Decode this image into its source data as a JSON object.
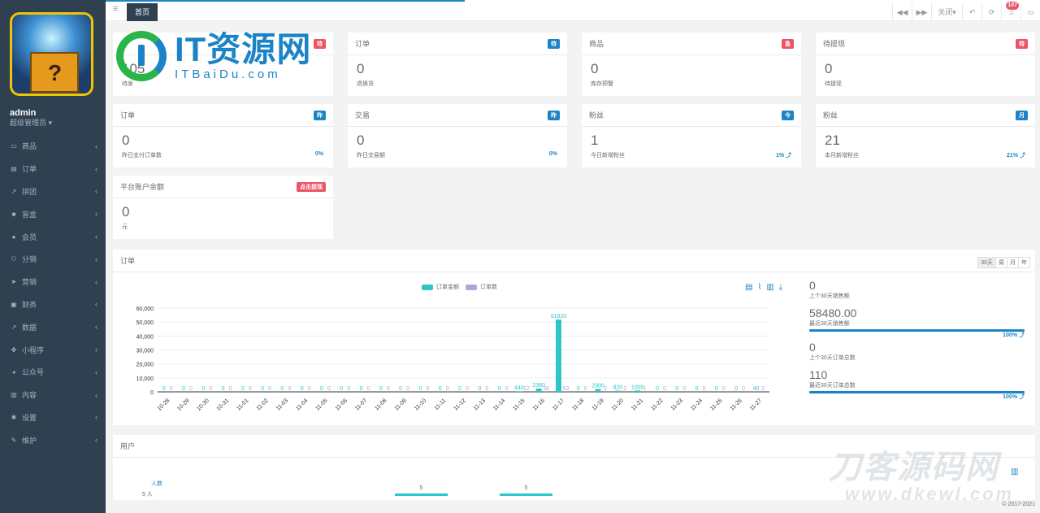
{
  "sidebar": {
    "user": "admin",
    "role": "超级管理员 ▾",
    "items": [
      {
        "label": "商品",
        "icon": "monitor-icon",
        "glyph": "▭"
      },
      {
        "label": "订单",
        "icon": "order-icon",
        "glyph": "▤"
      },
      {
        "label": "拼团",
        "icon": "chart-icon",
        "glyph": "↗"
      },
      {
        "label": "盲盒",
        "icon": "box-icon",
        "glyph": "■"
      },
      {
        "label": "会员",
        "icon": "user-icon",
        "glyph": "●"
      },
      {
        "label": "分销",
        "icon": "users-icon",
        "glyph": "⚇"
      },
      {
        "label": "营销",
        "icon": "send-icon",
        "glyph": "➤"
      },
      {
        "label": "财务",
        "icon": "money-icon",
        "glyph": "▣"
      },
      {
        "label": "数据",
        "icon": "line-chart-icon",
        "glyph": "↗"
      },
      {
        "label": "小程序",
        "icon": "share-icon",
        "glyph": "✤"
      },
      {
        "label": "公众号",
        "icon": "wechat-icon",
        "glyph": "◕"
      },
      {
        "label": "内容",
        "icon": "book-icon",
        "glyph": "▥"
      },
      {
        "label": "设置",
        "icon": "gear-icon",
        "glyph": "✱"
      },
      {
        "label": "维护",
        "icon": "wrench-icon",
        "glyph": "✎"
      }
    ]
  },
  "topbar": {
    "home_tab": "首页",
    "close_label": "关闭▾",
    "badge": "107"
  },
  "cards": [
    {
      "title": "订单",
      "tag": "待",
      "tag_color": "#1c84c6",
      "value": "0",
      "sub": "退换货",
      "pct": ""
    },
    {
      "title": "商品",
      "tag": "急",
      "tag_color": "#ed5565",
      "value": "0",
      "sub": "库存预警",
      "pct": ""
    },
    {
      "title": "待提现",
      "tag": "待",
      "tag_color": "#ed5565",
      "value": "0",
      "sub": "待提现",
      "pct": ""
    },
    {
      "title": "订单",
      "tag": "昨",
      "tag_color": "#1c84c6",
      "value": "0",
      "sub": "昨日支付订单数",
      "pct": "0%"
    },
    {
      "title": "交易",
      "tag": "昨",
      "tag_color": "#1c84c6",
      "value": "0",
      "sub": "昨日交易额",
      "pct": "0%"
    },
    {
      "title": "粉丝",
      "tag": "今",
      "tag_color": "#1c84c6",
      "value": "1",
      "sub": "今日新增粉丝",
      "pct": "1% ⤴"
    },
    {
      "title": "粉丝",
      "tag": "月",
      "tag_color": "#1c84c6",
      "value": "21",
      "sub": "本月新增粉丝",
      "pct": "21% ⤴"
    },
    {
      "title": "平台账户余额",
      "tag": "点击提现",
      "tag_color": "#ed5565",
      "value": "0",
      "sub": "元",
      "pct": ""
    }
  ],
  "first_card": {
    "title": "单",
    "value": "105",
    "sub": "待发"
  },
  "watermark": {
    "big": "IT资源网",
    "small": "ITBaiDu.com",
    "wm2": "刀客源码网",
    "wm2b": "www.dkewl.com"
  },
  "order_panel": {
    "title": "订单",
    "ranges": [
      "30天",
      "周",
      "月",
      "年"
    ],
    "legend": [
      "订单金额",
      "订单数"
    ],
    "stats": [
      {
        "value": "0",
        "label": "上个30天销售额",
        "pct": ""
      },
      {
        "value": "58480.00",
        "label": "最近30天销售额",
        "pct": "100% ⤴"
      },
      {
        "value": "0",
        "label": "上个30天订单总数",
        "pct": ""
      },
      {
        "value": "110",
        "label": "最近30天订单总数",
        "pct": "100% ⤴"
      }
    ]
  },
  "user_panel": {
    "title": "用户",
    "ylabel": "人数",
    "ytick": "5 人",
    "bars": [
      "5",
      "5"
    ]
  },
  "copyright": "© 2017-2021",
  "chart_data": {
    "type": "bar",
    "categories": [
      "10-28",
      "10-29",
      "10-30",
      "10-31",
      "11-01",
      "11-02",
      "11-03",
      "11-04",
      "11-05",
      "11-06",
      "11-07",
      "11-08",
      "11-09",
      "11-10",
      "11-11",
      "11-12",
      "11-13",
      "11-14",
      "11-15",
      "11-16",
      "11-17",
      "11-18",
      "11-19",
      "11-20",
      "11-21",
      "11-22",
      "11-23",
      "11-24",
      "11-25",
      "11-26",
      "11-27"
    ],
    "series": [
      {
        "name": "订单金额",
        "color": "#2ec7c9",
        "values": [
          0,
          0,
          0,
          0,
          0,
          0,
          0,
          0,
          0,
          0,
          0,
          0,
          0,
          0,
          0,
          0,
          0,
          0,
          440,
          2360,
          51820,
          0,
          2000,
          820,
          1000,
          0,
          0,
          0,
          0,
          0,
          40
        ]
      },
      {
        "name": "订单数",
        "color": "#b6a2de",
        "values": [
          0,
          0,
          0,
          0,
          0,
          0,
          0,
          0,
          0,
          0,
          0,
          0,
          0,
          0,
          0,
          0,
          0,
          0,
          12,
          38,
          53,
          0,
          2,
          2,
          1,
          0,
          0,
          0,
          0,
          0,
          2
        ]
      }
    ],
    "yticks": [
      "0",
      "10,000",
      "20,000",
      "30,000",
      "40,000",
      "50,000",
      "60,000"
    ],
    "ylim": [
      0,
      60000
    ]
  }
}
